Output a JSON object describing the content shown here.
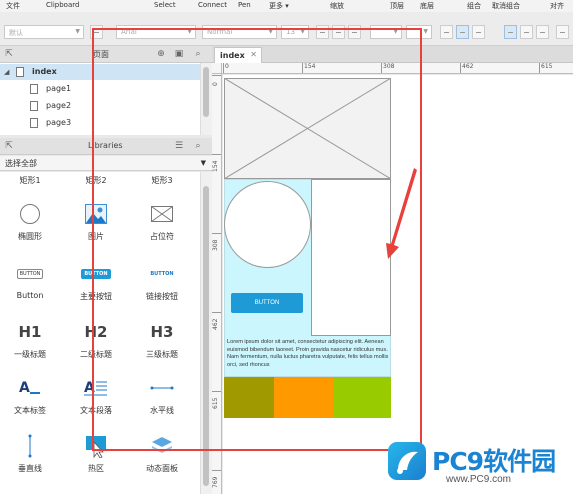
{
  "menu": {
    "items": [
      "文件",
      "Clipboard",
      "Select",
      "Connect",
      "Pen",
      "更多 ▾",
      "缩放",
      "顶层",
      "底层",
      "组合",
      "取消组合",
      "对齐"
    ]
  },
  "toolbar": {
    "page_style": "默认",
    "font": "Arial",
    "weight": "Normal",
    "size": "13"
  },
  "pages_panel": {
    "title": "页面",
    "root": "index",
    "children": [
      "page1",
      "page2",
      "page3"
    ]
  },
  "libraries_panel": {
    "title": "Libraries",
    "selector": "选择全部",
    "top_row": [
      "矩形1",
      "矩形2",
      "矩形3"
    ],
    "widgets": [
      {
        "label": "椭圆形",
        "icon": "ellipse-icon"
      },
      {
        "label": "图片",
        "icon": "image-icon"
      },
      {
        "label": "占位符",
        "icon": "placeholder-icon"
      },
      {
        "label": "Button",
        "icon": "button-icon",
        "icon_text": "BUTTON"
      },
      {
        "label": "主要按钮",
        "icon": "primary-button-icon",
        "icon_text": "BUTTON"
      },
      {
        "label": "链接按钮",
        "icon": "link-button-icon",
        "icon_text": "BUTTON"
      },
      {
        "label": "一级标题",
        "icon": "h1-icon",
        "icon_text": "H1"
      },
      {
        "label": "二级标题",
        "icon": "h2-icon",
        "icon_text": "H2"
      },
      {
        "label": "三级标题",
        "icon": "h3-icon",
        "icon_text": "H3"
      },
      {
        "label": "文本标签",
        "icon": "text-label-icon"
      },
      {
        "label": "文本段落",
        "icon": "paragraph-icon"
      },
      {
        "label": "水平线",
        "icon": "horizontal-line-icon"
      },
      {
        "label": "垂直线",
        "icon": "vertical-line-icon"
      },
      {
        "label": "热区",
        "icon": "hotspot-icon"
      },
      {
        "label": "动态面板",
        "icon": "dynamic-panel-icon"
      }
    ]
  },
  "tab": {
    "label": "index"
  },
  "ruler": {
    "h": [
      "0",
      "154",
      "308",
      "462",
      "615"
    ],
    "v": [
      "0",
      "154",
      "308",
      "462",
      "615",
      "769"
    ]
  },
  "canvas": {
    "button_label": "BUTTON",
    "paragraph": "Lorem ipsum dolor sit amet, consectetur adipiscing elit. Aenean euismod bibendum laoreet. Proin gravida nascetur ridiculus mus. Nam fermentum, nulla luctus pharetra vulputate, felis tellus mollis orci, sed rhoncus",
    "colors": {
      "cyan": "#ccf6fd",
      "olive": "#a09900",
      "orange": "#ff9900",
      "lime": "#99cc00",
      "button": "#1e9bd7",
      "annotation": "#e8403a"
    }
  },
  "watermark": {
    "name": "PC9软件园",
    "url": "www.PC9.com"
  }
}
